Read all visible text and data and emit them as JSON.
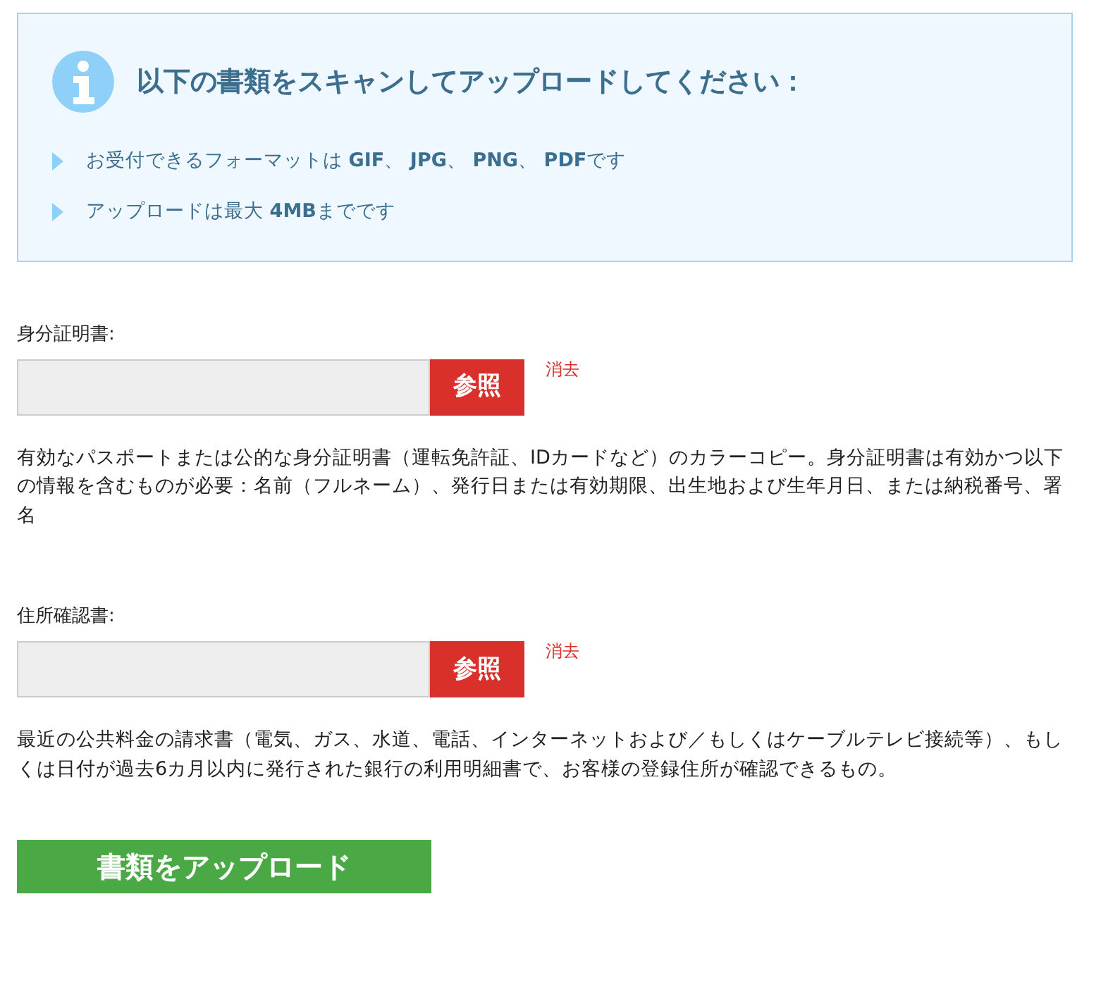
{
  "notice": {
    "title": "以下の書類をスキャンしてアップロードしてください：",
    "items": [
      "お受付できるフォーマットは **GIF**、 **JPG**、 **PNG**、 **PDF**です",
      "アップロードは最大 **4MB**までです"
    ]
  },
  "documents": [
    {
      "label": "身分証明書:",
      "browse": "参照",
      "clear": "消去",
      "description": "有効なパスポートまたは公的な身分証明書（運転免許証、IDカードなど）のカラーコピー。身分証明書は有効かつ以下の情報を含むものが必要：名前（フルネーム）、発行日または有効期限、出生地および生年月日、または納税番号、署名"
    },
    {
      "label": "住所確認書:",
      "browse": "参照",
      "clear": "消去",
      "description": "最近の公共料金の請求書（電気、ガス、水道、電話、インターネットおよび／もしくはケーブルテレビ接続等）、もしくは日付が過去6カ月以内に発行された銀行の利用明細書で、お客様の登録住所が確認できるもの。"
    }
  ],
  "submit": "書類をアップロード"
}
